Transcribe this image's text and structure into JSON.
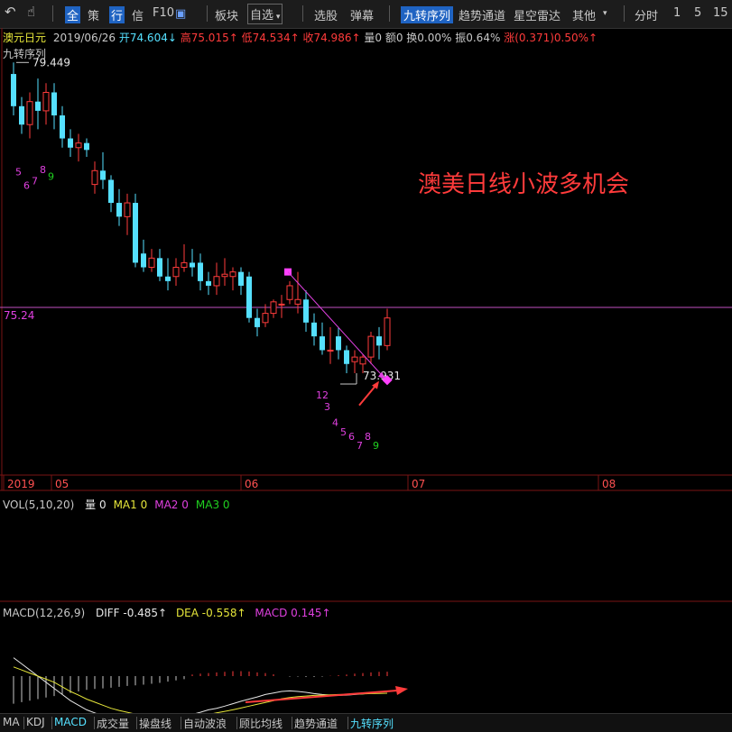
{
  "toolbar": {
    "items": [
      "全",
      "策",
      "行",
      "信",
      "F10",
      "板块",
      "自选",
      "选股",
      "弹幕",
      "九转序列",
      "趋势通道",
      "星空雷达",
      "其他",
      "分时",
      "1",
      "5",
      "15"
    ]
  },
  "info_bar": {
    "name": "澳元日元",
    "date": "2019/06/26",
    "open": "开74.604↓",
    "high": "高75.015↑",
    "low": "低74.534↑",
    "close": "收74.986↑",
    "vol": "量0",
    "amount": "额0",
    "turnover": "换0.00%",
    "amplitude": "振0.64%",
    "change": "涨(0.371)0.50%↑"
  },
  "indicator_label": "九转序列",
  "annotation": "澳美日线小波多机会",
  "hline_label": "75.24",
  "date_axis": [
    "2019",
    "05",
    "06",
    "07",
    "08"
  ],
  "vol_panel": {
    "title": "VOL(5,10,20)",
    "items": [
      {
        "label": "量",
        "value": "0",
        "color": "#e6e6e6"
      },
      {
        "label": "MA1",
        "value": "0",
        "color": "#e6e63a"
      },
      {
        "label": "MA2",
        "value": "0",
        "color": "#e040e0"
      },
      {
        "label": "MA3",
        "value": "0",
        "color": "#20d020"
      }
    ]
  },
  "macd_panel": {
    "title": "MACD(12,26,9)",
    "diff": "DIFF -0.485↑",
    "dea": "DEA -0.558↑",
    "macd": "MACD 0.145↑"
  },
  "bottom_tabs": [
    "MA",
    "KDJ",
    "MACD",
    "成交量",
    "操盘线",
    "自动波浪",
    "顾比均线",
    "趋势通道",
    "九转序列"
  ],
  "colors": {
    "up": "#ff3b3b",
    "down": "#55e0ff",
    "accent": "#e040e0",
    "green": "#20d020"
  },
  "chart_data": {
    "type": "candlestick",
    "ylim": [
      73.0,
      80.5
    ],
    "high_label": "79.449",
    "low_label": "73.931",
    "candles": [
      {
        "o": 79.2,
        "h": 79.45,
        "c": 78.5,
        "l": 78.3
      },
      {
        "o": 78.5,
        "h": 78.7,
        "c": 78.1,
        "l": 77.9
      },
      {
        "o": 78.1,
        "h": 78.8,
        "c": 78.6,
        "l": 77.8
      },
      {
        "o": 78.6,
        "h": 79.1,
        "c": 78.4,
        "l": 78.0
      },
      {
        "o": 78.4,
        "h": 79.0,
        "c": 78.8,
        "l": 78.1
      },
      {
        "o": 78.8,
        "h": 79.0,
        "c": 78.3,
        "l": 78.0
      },
      {
        "o": 78.3,
        "h": 78.5,
        "c": 77.8,
        "l": 77.6
      },
      {
        "o": 77.8,
        "h": 78.0,
        "c": 77.6,
        "l": 77.4
      },
      {
        "o": 77.6,
        "h": 77.9,
        "c": 77.7,
        "l": 77.3
      },
      {
        "o": 77.7,
        "h": 77.8,
        "c": 77.55,
        "l": 77.4
      },
      {
        "o": 76.8,
        "h": 77.3,
        "c": 77.1,
        "l": 76.6
      },
      {
        "o": 77.1,
        "h": 77.5,
        "c": 76.9,
        "l": 76.7
      },
      {
        "o": 76.9,
        "h": 77.0,
        "c": 76.4,
        "l": 76.2
      },
      {
        "o": 76.4,
        "h": 76.7,
        "c": 76.1,
        "l": 75.9
      },
      {
        "o": 76.1,
        "h": 76.6,
        "c": 76.4,
        "l": 75.7
      },
      {
        "o": 76.4,
        "h": 76.6,
        "c": 75.1,
        "l": 75.0
      },
      {
        "o": 75.3,
        "h": 75.6,
        "c": 75.0,
        "l": 74.9
      },
      {
        "o": 75.0,
        "h": 75.4,
        "c": 75.2,
        "l": 74.9
      },
      {
        "o": 75.2,
        "h": 75.4,
        "c": 74.8,
        "l": 74.7
      },
      {
        "o": 74.8,
        "h": 75.2,
        "c": 74.7,
        "l": 74.5
      },
      {
        "o": 74.8,
        "h": 75.2,
        "c": 75.0,
        "l": 74.6
      },
      {
        "o": 75.0,
        "h": 75.5,
        "c": 75.1,
        "l": 74.9
      },
      {
        "o": 75.1,
        "h": 75.4,
        "c": 75.0,
        "l": 74.8
      },
      {
        "o": 75.1,
        "h": 75.3,
        "c": 74.7,
        "l": 74.5
      },
      {
        "o": 74.7,
        "h": 74.9,
        "c": 74.6,
        "l": 74.4
      },
      {
        "o": 74.6,
        "h": 75.1,
        "c": 74.8,
        "l": 74.4
      },
      {
        "o": 74.8,
        "h": 75.2,
        "c": 74.85,
        "l": 74.6
      },
      {
        "o": 74.8,
        "h": 75.0,
        "c": 74.9,
        "l": 74.5
      },
      {
        "o": 74.9,
        "h": 75.0,
        "c": 74.6,
        "l": 74.4
      },
      {
        "o": 74.8,
        "h": 74.9,
        "c": 73.9,
        "l": 73.8
      },
      {
        "o": 73.9,
        "h": 74.1,
        "c": 73.7,
        "l": 73.5
      },
      {
        "o": 73.8,
        "h": 74.2,
        "c": 74.0,
        "l": 73.7
      },
      {
        "o": 74.0,
        "h": 74.3,
        "c": 74.25,
        "l": 73.9
      },
      {
        "o": 74.2,
        "h": 74.4,
        "c": 74.2,
        "l": 73.9
      },
      {
        "o": 74.3,
        "h": 74.7,
        "c": 74.6,
        "l": 74.2
      },
      {
        "o": 74.2,
        "h": 74.9,
        "c": 74.3,
        "l": 74.0
      },
      {
        "o": 74.3,
        "h": 74.5,
        "c": 73.8,
        "l": 73.6
      },
      {
        "o": 73.8,
        "h": 74.0,
        "c": 73.5,
        "l": 73.3
      },
      {
        "o": 73.5,
        "h": 73.8,
        "c": 73.2,
        "l": 73.1
      },
      {
        "o": 73.2,
        "h": 73.7,
        "c": 73.2,
        "l": 72.9
      },
      {
        "o": 73.5,
        "h": 73.7,
        "c": 73.2,
        "l": 73.0
      },
      {
        "o": 73.2,
        "h": 73.3,
        "c": 72.9,
        "l": 72.7
      },
      {
        "o": 72.95,
        "h": 73.2,
        "c": 73.05,
        "l": 72.7
      },
      {
        "o": 72.9,
        "h": 73.1,
        "c": 73.05,
        "l": 72.7
      },
      {
        "o": 73.05,
        "h": 73.6,
        "c": 73.5,
        "l": 72.9
      },
      {
        "o": 73.5,
        "h": 73.7,
        "c": 73.3,
        "l": 73.0
      },
      {
        "o": 73.3,
        "h": 74.1,
        "c": 73.9,
        "l": 73.2
      }
    ],
    "tds_labels": [
      {
        "t": "5",
        "i": 1,
        "v": 77.0
      },
      {
        "t": "6",
        "i": 2,
        "v": 76.7
      },
      {
        "t": "7",
        "i": 3,
        "v": 76.8
      },
      {
        "t": "8",
        "i": 4,
        "v": 77.05
      },
      {
        "t": "9",
        "i": 5,
        "v": 76.9
      },
      {
        "t": "12",
        "i": 38,
        "v": 72.15
      },
      {
        "t": "3",
        "i": 39,
        "v": 71.9
      },
      {
        "t": "4",
        "i": 40,
        "v": 71.55
      },
      {
        "t": "5",
        "i": 41,
        "v": 71.35
      },
      {
        "t": "6",
        "i": 42,
        "v": 71.25
      },
      {
        "t": "7",
        "i": 43,
        "v": 71.05
      },
      {
        "t": "8",
        "i": 44,
        "v": 71.25
      },
      {
        "t": "9",
        "i": 45,
        "v": 71.05
      }
    ],
    "macd_hist": [
      -0.9,
      -0.85,
      -0.8,
      -0.75,
      -0.7,
      -0.65,
      -0.6,
      -0.55,
      -0.5,
      -0.45,
      -0.42,
      -0.4,
      -0.38,
      -0.35,
      -0.32,
      -0.3,
      -0.28,
      -0.25,
      -0.22,
      -0.18,
      -0.14,
      -0.1,
      0.05,
      0.08,
      0.1,
      0.12,
      0.14,
      0.16,
      0.16,
      0.15,
      0.12,
      0.1,
      0.06,
      0.0,
      -0.02,
      -0.02,
      -0.03,
      -0.03,
      -0.02,
      0.01,
      0.03,
      0.05,
      0.08,
      0.1,
      0.12,
      0.14,
      0.145
    ],
    "macd_diff": [
      0.6,
      0.4,
      0.2,
      0.0,
      -0.2,
      -0.4,
      -0.6,
      -0.8,
      -0.95,
      -1.1,
      -1.2,
      -1.3,
      -1.35,
      -1.4,
      -1.42,
      -1.44,
      -1.45,
      -1.44,
      -1.42,
      -1.4,
      -1.35,
      -1.3,
      -1.25,
      -1.18,
      -1.1,
      -1.05,
      -0.98,
      -0.9,
      -0.82,
      -0.75,
      -0.68,
      -0.6,
      -0.55,
      -0.5,
      -0.48,
      -0.5,
      -0.53,
      -0.57,
      -0.6,
      -0.62,
      -0.63,
      -0.62,
      -0.6,
      -0.58,
      -0.55,
      -0.52,
      -0.485
    ],
    "macd_dea": [
      0.3,
      0.2,
      0.1,
      0.0,
      -0.1,
      -0.2,
      -0.35,
      -0.5,
      -0.62,
      -0.75,
      -0.85,
      -0.95,
      -1.05,
      -1.12,
      -1.18,
      -1.24,
      -1.28,
      -1.32,
      -1.34,
      -1.35,
      -1.35,
      -1.34,
      -1.32,
      -1.29,
      -1.25,
      -1.2,
      -1.15,
      -1.1,
      -1.04,
      -0.98,
      -0.92,
      -0.86,
      -0.8,
      -0.74,
      -0.7,
      -0.67,
      -0.65,
      -0.63,
      -0.62,
      -0.61,
      -0.6,
      -0.6,
      -0.59,
      -0.58,
      -0.57,
      -0.565,
      -0.558
    ]
  }
}
